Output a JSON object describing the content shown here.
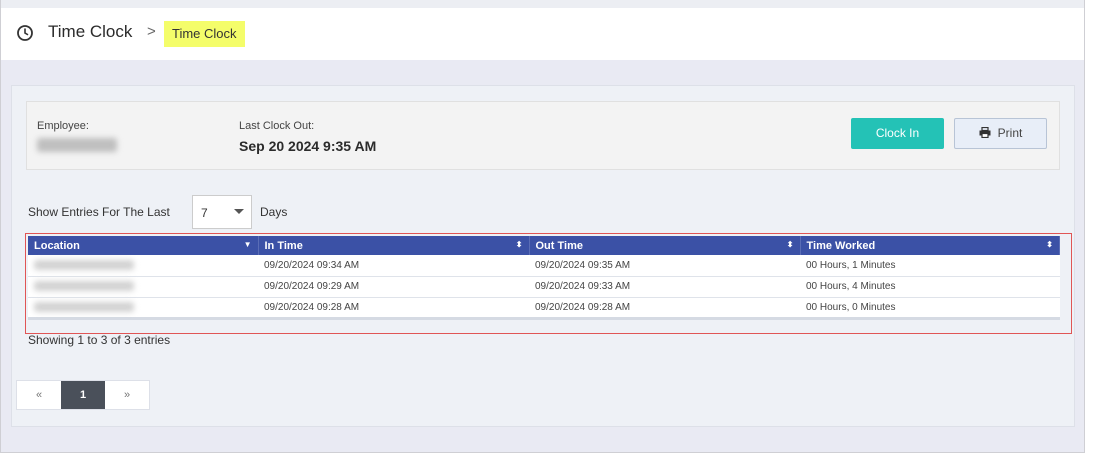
{
  "header": {
    "title": "Time Clock",
    "breadcrumb_separator": ">",
    "breadcrumb_current": "Time Clock",
    "highlight_color": "#f4fd6a"
  },
  "employee_panel": {
    "employee_label": "Employee:",
    "last_clock_out_label": "Last Clock Out:",
    "last_clock_out_value": "Sep 20 2024 9:35 AM",
    "clock_in_button": "Clock In",
    "print_button": "Print",
    "accent_color": "#24c2b6"
  },
  "filter": {
    "show_entries_label": "Show Entries For The Last",
    "days_value": "7",
    "days_label": "Days"
  },
  "table": {
    "header_color": "#3b51a6",
    "columns": [
      "Location",
      "In Time",
      "Out Time",
      "Time Worked"
    ],
    "rows": [
      {
        "location": "",
        "in_time": "09/20/2024 09:34 AM",
        "out_time": "09/20/2024 09:35 AM",
        "time_worked": "00 Hours, 1 Minutes"
      },
      {
        "location": "",
        "in_time": "09/20/2024 09:29 AM",
        "out_time": "09/20/2024 09:33 AM",
        "time_worked": "00 Hours, 4 Minutes"
      },
      {
        "location": "",
        "in_time": "09/20/2024 09:28 AM",
        "out_time": "09/20/2024 09:28 AM",
        "time_worked": "00 Hours, 0 Minutes"
      }
    ]
  },
  "footer": {
    "showing_text": "Showing 1 to 3 of 3 entries"
  },
  "pagination": {
    "prev": "«",
    "current_page": "1",
    "next": "»"
  }
}
